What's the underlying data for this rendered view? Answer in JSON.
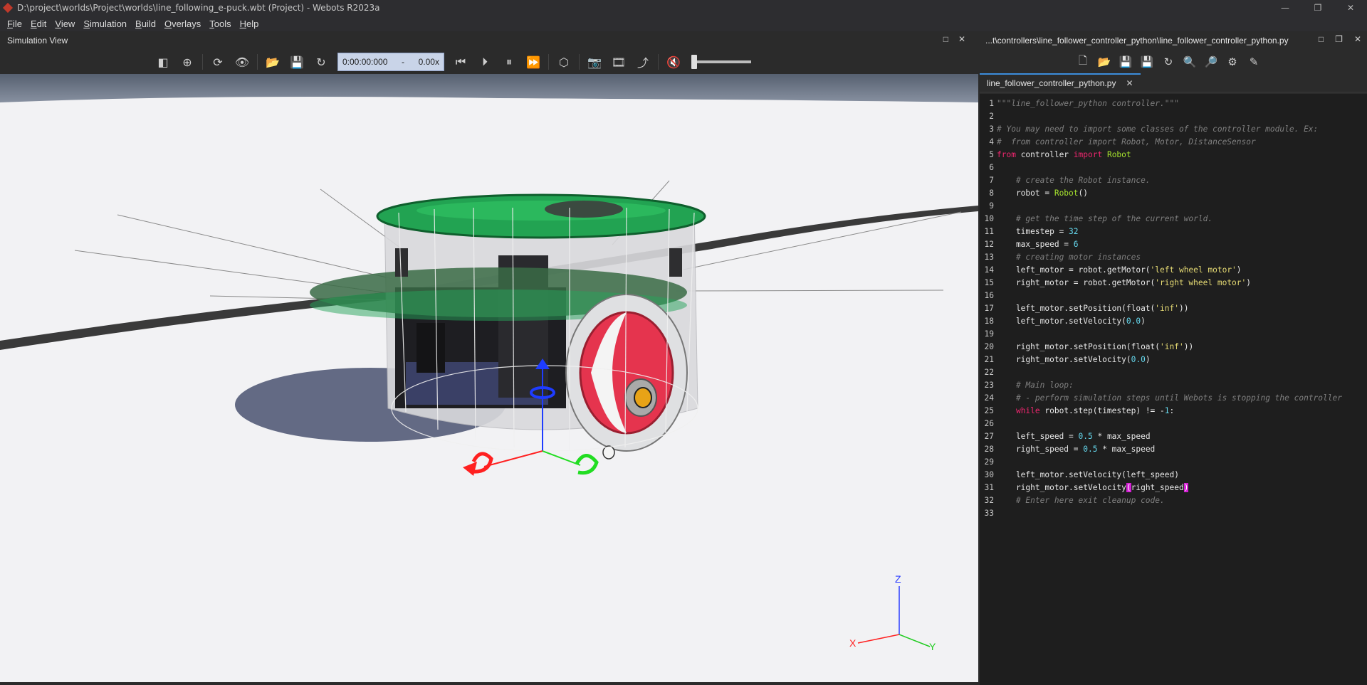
{
  "window": {
    "title": "D:\\project\\worlds\\Project\\worlds\\line_following_e-puck.wbt (Project) - Webots R2023a",
    "controls": [
      "—",
      "❐",
      "✕"
    ]
  },
  "menu": [
    "File",
    "Edit",
    "View",
    "Simulation",
    "Build",
    "Overlays",
    "Tools",
    "Help"
  ],
  "sim": {
    "title": "Simulation View",
    "time": "0:00:00:000",
    "time_sep": "-",
    "speed": "0.00x",
    "header_btns": [
      "□",
      "✕"
    ]
  },
  "editor": {
    "path": "...t\\controllers\\line_follower_controller_python\\line_follower_controller_python.py",
    "header_btns": [
      "□",
      "❐",
      "✕"
    ],
    "tab": "line_follower_controller_python.py",
    "tab_close": "✕",
    "lines": [
      {
        "n": "1",
        "t": "\"\"\"line_follower_python controller.\"\"\""
      },
      {
        "n": "2",
        "t": ""
      },
      {
        "n": "3",
        "t": "# You may need to import some classes of the controller module. Ex:"
      },
      {
        "n": "4",
        "t": "#  from controller import Robot, Motor, DistanceSensor"
      },
      {
        "n": "5",
        "t": "from controller import Robot"
      },
      {
        "n": "6",
        "t": ""
      },
      {
        "n": "7",
        "t": "    # create the Robot instance."
      },
      {
        "n": "8",
        "t": "    robot = Robot()"
      },
      {
        "n": "9",
        "t": ""
      },
      {
        "n": "10",
        "t": "    # get the time step of the current world."
      },
      {
        "n": "11",
        "t": "    timestep = 32"
      },
      {
        "n": "12",
        "t": "    max_speed = 6"
      },
      {
        "n": "13",
        "t": "    # creating motor instances"
      },
      {
        "n": "14",
        "t": "    left_motor = robot.getMotor('left wheel motor')"
      },
      {
        "n": "15",
        "t": "    right_motor = robot.getMotor('right wheel motor')"
      },
      {
        "n": "16",
        "t": ""
      },
      {
        "n": "17",
        "t": "    left_motor.setPosition(float('inf'))"
      },
      {
        "n": "18",
        "t": "    left_motor.setVelocity(0.0)"
      },
      {
        "n": "19",
        "t": ""
      },
      {
        "n": "20",
        "t": "    right_motor.setPosition(float('inf'))"
      },
      {
        "n": "21",
        "t": "    right_motor.setVelocity(0.0)"
      },
      {
        "n": "22",
        "t": ""
      },
      {
        "n": "23",
        "t": "    # Main loop:"
      },
      {
        "n": "24",
        "t": "    # - perform simulation steps until Webots is stopping the controller"
      },
      {
        "n": "25",
        "t": "    while robot.step(timestep) != -1:"
      },
      {
        "n": "26",
        "t": ""
      },
      {
        "n": "27",
        "t": "    left_speed = 0.5 * max_speed"
      },
      {
        "n": "28",
        "t": "    right_speed = 0.5 * max_speed"
      },
      {
        "n": "29",
        "t": ""
      },
      {
        "n": "30",
        "t": "    left_motor.setVelocity(left_speed)"
      },
      {
        "n": "31",
        "t": "    right_motor.setVelocity(right_speed)"
      },
      {
        "n": "32",
        "t": "    # Enter here exit cleanup code."
      },
      {
        "n": "33",
        "t": ""
      }
    ]
  },
  "axes": {
    "x": "X",
    "y": "Y",
    "z": "Z"
  },
  "colors": {
    "accent": "#3c8ddc",
    "bracket_highlight": "#d41fd4",
    "keyword": "#f0266f",
    "class": "#a6e22e",
    "string": "#e6db74",
    "number": "#66d9ef"
  }
}
